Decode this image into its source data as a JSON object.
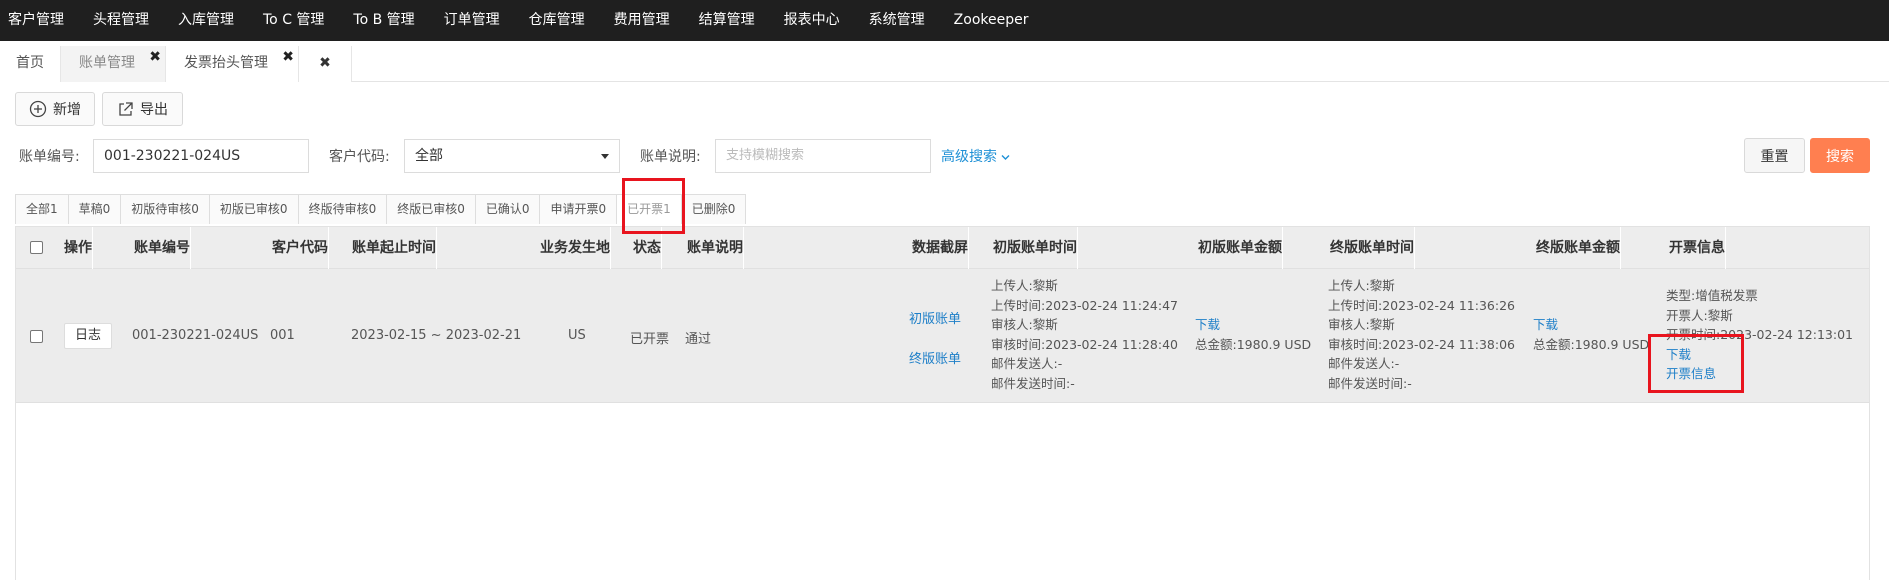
{
  "topnav": {
    "items": [
      "客户管理",
      "头程管理",
      "入库管理",
      "To C 管理",
      "To B 管理",
      "订单管理",
      "仓库管理",
      "费用管理",
      "结算管理",
      "报表中心",
      "系统管理",
      "Zookeeper"
    ]
  },
  "tabs": {
    "home": "首页",
    "bill": "账单管理",
    "invoice_header": "发票抬头管理",
    "close_symbol": "✖"
  },
  "toolbar": {
    "add_label": "新增",
    "export_label": "导出"
  },
  "filters": {
    "bill_no_label": "账单编号:",
    "bill_no_value": "001-230221-024US",
    "customer_label": "客户代码:",
    "customer_value": "全部",
    "desc_label": "账单说明:",
    "desc_placeholder": "支持模糊搜索",
    "advanced_label": "高级搜索",
    "reset_label": "重置",
    "search_label": "搜索"
  },
  "status_tabs": [
    "全部1",
    "草稿0",
    "初版待审核0",
    "初版已审核0",
    "终版待审核0",
    "终版已审核0",
    "已确认0",
    "申请开票0",
    "已开票1",
    "已删除0"
  ],
  "table": {
    "headers": {
      "op": "操作",
      "bill_no": "账单编号",
      "customer": "客户代码",
      "period": "账单起止时间",
      "place": "业务发生地",
      "status": "状态",
      "desc": "账单说明",
      "snapshot": "数据截屏",
      "first_time": "初版账单时间",
      "first_amount": "初版账单金额",
      "final_time": "终版账单时间",
      "final_amount": "终版账单金额",
      "invoice": "开票信息"
    },
    "row": {
      "log": "日志",
      "bill_no": "001-230221-024US",
      "customer": "001",
      "period": "2023-02-15 ~ 2023-02-21",
      "place": "US",
      "status": "已开票",
      "desc": "通过",
      "snapshot_first": "初版账单",
      "snapshot_final": "终版账单",
      "first_time": [
        "上传人:黎斯",
        "上传时间:2023-02-24 11:24:47",
        "审核人:黎斯",
        "审核时间:2023-02-24 11:28:40",
        "邮件发送人:-",
        "邮件发送时间:-"
      ],
      "first_download": "下载",
      "first_total": "总金额:1980.9 USD",
      "final_time": [
        "上传人:黎斯",
        "上传时间:2023-02-24 11:36:26",
        "审核人:黎斯",
        "审核时间:2023-02-24 11:38:06",
        "邮件发送人:-",
        "邮件发送时间:-"
      ],
      "final_download": "下载",
      "final_total": "总金额:1980.9 USD",
      "invoice_type": "类型:增值税发票",
      "invoice_person": "开票人:黎斯",
      "invoice_time": "开票时间:2023-02-24 12:13:01",
      "invoice_download": "下载",
      "invoice_info": "开票信息"
    }
  },
  "colors": {
    "nav_bg": "#1f1f1f",
    "search_btn": "#ff7f50",
    "link": "#1e7fc8",
    "highlight": "#e8141e"
  }
}
